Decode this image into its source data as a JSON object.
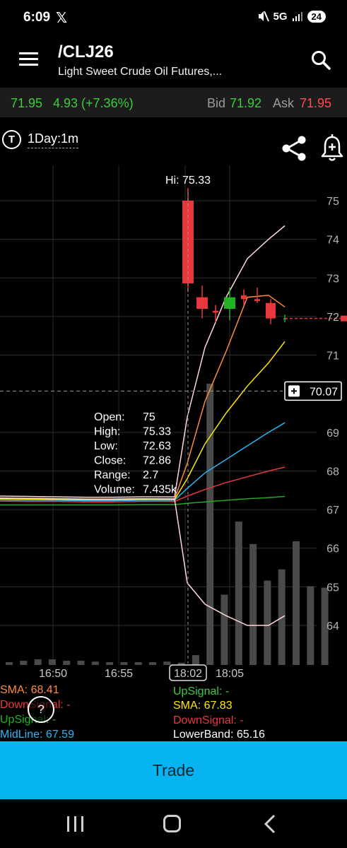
{
  "status_bar": {
    "time": "6:09",
    "social": "𝕏",
    "network": "5G",
    "battery": "24",
    "icons": [
      "mute-icon",
      "signal-icon"
    ]
  },
  "header": {
    "title": "/CLJ26",
    "subtitle": "Light Sweet Crude Oil Futures,...",
    "icons": [
      "menu-icon",
      "search-icon"
    ]
  },
  "quote": {
    "last": "71.95",
    "change": "4.93 (+7.36%)",
    "bid_label": "Bid",
    "bid": "71.92",
    "ask_label": "Ask",
    "ask": "71.95"
  },
  "toolbar": {
    "t_label": "T",
    "interval": "1Day:1m",
    "icons": [
      "share-icon",
      "alert-bell-icon"
    ]
  },
  "colors": {
    "up": "#22b222",
    "down": "#e8383d",
    "accent": "#05b4f0",
    "quote_up": "#3ccd3c",
    "quote_down": "#ff4d4d"
  },
  "chart_data": {
    "type": "candlestick",
    "y_ticks": [
      75,
      74,
      73,
      72,
      71,
      69,
      68,
      67,
      66,
      65,
      64
    ],
    "y_tick_labels": [
      "75",
      "74",
      "73",
      "72",
      "71",
      "69",
      "68",
      "67",
      "66",
      "65",
      "64"
    ],
    "ylim": [
      63.0,
      76.2
    ],
    "x_tick_labels": [
      "16:50",
      "16:55",
      "18:02",
      "18:05"
    ],
    "hi_label": "Hi: 75.33",
    "crosshair_price": "70.07",
    "last_price": 71.95,
    "candles": [
      {
        "open": 75.0,
        "high": 75.33,
        "low": 72.63,
        "close": 72.86
      },
      {
        "open": 72.5,
        "high": 72.8,
        "low": 71.95,
        "close": 72.2
      },
      {
        "open": 72.15,
        "high": 72.3,
        "low": 71.85,
        "close": 72.1
      },
      {
        "open": 72.2,
        "high": 72.75,
        "low": 71.9,
        "close": 72.5
      },
      {
        "open": 72.55,
        "high": 72.7,
        "low": 72.3,
        "close": 72.45
      },
      {
        "open": 72.45,
        "high": 72.75,
        "low": 72.35,
        "close": 72.4
      },
      {
        "open": 72.35,
        "high": 72.45,
        "low": 71.8,
        "close": 71.95
      },
      {
        "open": 71.95,
        "high": 72.05,
        "low": 71.85,
        "close": 71.95
      }
    ],
    "tooltip": [
      {
        "label": "Open:",
        "value": "75"
      },
      {
        "label": "High:",
        "value": "75.33"
      },
      {
        "label": "Low:",
        "value": "72.63"
      },
      {
        "label": "Close:",
        "value": "72.86"
      },
      {
        "label": "Range:",
        "value": "2.7"
      },
      {
        "label": "Volume:",
        "value": "7.435k"
      }
    ],
    "volume_bars": [
      0.01,
      0.015,
      0.02,
      0.02,
      0.015,
      0.015,
      0.012,
      0.01,
      0.01,
      0.01,
      0.01,
      0.012,
      0.008,
      0.035,
      1.0,
      0.25,
      0.51,
      0.43,
      0.3,
      0.34,
      0.44,
      0.28,
      0.275
    ],
    "series": [
      {
        "name": "Upper Band",
        "color": "#ffd8d8",
        "values": [
          67.35,
          67.34,
          67.33,
          67.32,
          67.32,
          67.33,
          67.33,
          69.4,
          71.2,
          72.5,
          73.5,
          74.0,
          74.35
        ]
      },
      {
        "name": "SMA",
        "color": "#ff8c3a",
        "values": [
          67.3,
          67.29,
          67.28,
          67.27,
          67.27,
          67.28,
          67.28,
          68.2,
          69.8,
          71.1,
          72.5,
          72.55,
          72.25
        ]
      },
      {
        "name": "SMA",
        "color": "#ffe800",
        "values": [
          67.28,
          67.27,
          67.26,
          67.25,
          67.25,
          67.26,
          67.26,
          67.8,
          68.7,
          69.5,
          70.2,
          70.8,
          71.35
        ]
      },
      {
        "name": "MidLine",
        "color": "#29b6f6",
        "values": [
          67.25,
          67.24,
          67.24,
          67.23,
          67.23,
          67.24,
          67.24,
          67.55,
          67.95,
          68.3,
          68.65,
          69.0,
          69.25
        ]
      },
      {
        "name": "DownSignal",
        "color": "#e8383d",
        "values": [
          67.22,
          67.21,
          67.21,
          67.2,
          67.2,
          67.21,
          67.21,
          67.35,
          67.52,
          67.7,
          67.85,
          68.0,
          68.1
        ]
      },
      {
        "name": "UpSignal",
        "color": "#22a822",
        "values": [
          67.12,
          67.12,
          67.12,
          67.12,
          67.12,
          67.13,
          67.13,
          67.16,
          67.2,
          67.24,
          67.28,
          67.31,
          67.34
        ]
      },
      {
        "name": "Lower Band",
        "color": "#ffd8d8",
        "values": [
          67.3,
          67.29,
          67.28,
          67.27,
          67.27,
          67.28,
          67.27,
          65.1,
          64.55,
          64.25,
          64.0,
          64.0,
          64.25
        ]
      }
    ],
    "legend_left": [
      {
        "label": "SMA: 68.41",
        "color": "#ff8c3a"
      },
      {
        "label": "DownSignal: -",
        "color": "#e8383d"
      },
      {
        "label": "UpSignal: -",
        "color": "#22b222"
      },
      {
        "label": "MidLine: 67.59",
        "color": "#29b6f6"
      }
    ],
    "legend_right": [
      {
        "label": "UpSignal: -",
        "color": "#3ccd3c"
      },
      {
        "label": "SMA: 67.83",
        "color": "#ffe800"
      },
      {
        "label": "DownSignal: -",
        "color": "#e8383d"
      },
      {
        "label": "LowerBand: 65.16",
        "color": "#ffffff"
      }
    ]
  },
  "help_label": "?",
  "trade_button": {
    "label": "Trade"
  },
  "nav": {
    "icons": [
      "recents-icon",
      "home-icon",
      "back-icon"
    ]
  }
}
